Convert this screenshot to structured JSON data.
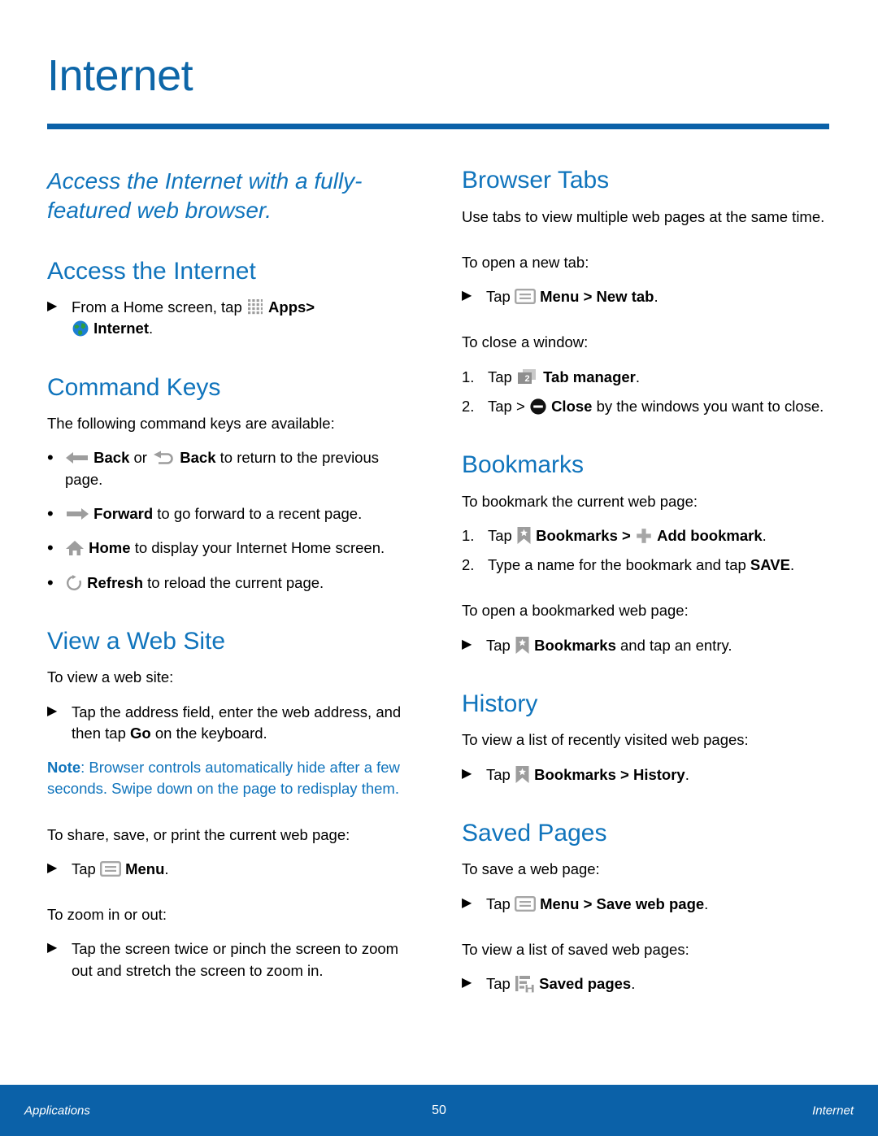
{
  "document": {
    "title": "Internet",
    "accent_color": "#0b61a8",
    "heading_color": "#1074bc",
    "lede": "Access the Internet with a fully-featured web browser."
  },
  "left_column": {
    "access": {
      "heading": "Access the Internet",
      "step": {
        "marker": "▶",
        "text_before_apps": "From a Home screen, tap",
        "apps_label": "Apps",
        "separator": ">",
        "internet_label": "Internet",
        "period": "."
      }
    },
    "command_keys": {
      "heading": "Command Keys",
      "intro": "The following command keys are available:",
      "items": [
        {
          "marker": "•",
          "icon": "back-arrow-icon",
          "label": "Back",
          "mid": "or",
          "icon2": "back-return-icon",
          "label2": "Back",
          "after": "to return to the previous page."
        },
        {
          "marker": "•",
          "icon": "forward-arrow-icon",
          "label": "Forward",
          "after": "to go forward to a recent page."
        },
        {
          "marker": "•",
          "icon": "home-icon",
          "label": "Home",
          "after": "to display your Internet Home screen."
        },
        {
          "marker": "•",
          "icon": "refresh-icon",
          "label": "Refresh",
          "after": "to reload the current page."
        }
      ]
    },
    "view_web_site": {
      "heading": "View a Web Site",
      "intro": "To view a web site:",
      "step": {
        "marker": "▶",
        "before": "Tap the address field, enter the web address, and then tap",
        "bold": "Go",
        "after": "on the keyboard."
      },
      "note": {
        "label": "Note",
        "colon": ":",
        "text": "Browser controls automatically hide after a few seconds. Swipe down on the page to redisplay them."
      },
      "share_intro": "To share, save, or print the current web page:",
      "share_step": {
        "marker": "▶",
        "before": "Tap",
        "menu_label": "Menu",
        "period": "."
      },
      "zoom_intro": "To zoom in or out:",
      "zoom_step": {
        "marker": "▶",
        "text": "Tap the screen twice or pinch the screen to zoom out and stretch the screen to zoom in."
      }
    }
  },
  "right_column": {
    "browser_tabs": {
      "heading": "Browser Tabs",
      "intro": "Use tabs to view multiple web pages at the same time.",
      "new_tab_intro": "To open a new tab:",
      "new_tab_step": {
        "marker": "▶",
        "before": "Tap",
        "menu_label": "Menu",
        "separator": ">",
        "target_label": "New tab",
        "period": "."
      },
      "close_intro": "To close a window:",
      "close_steps": [
        {
          "marker": "1.",
          "before": "Tap",
          "icon": "tab-manager-icon",
          "badge": "2",
          "label": "Tab manager",
          "period": "."
        },
        {
          "marker": "2.",
          "before": "Tap >",
          "icon": "close-icon",
          "label": "Close",
          "after": "by the windows you want to close."
        }
      ]
    },
    "bookmarks": {
      "heading": "Bookmarks",
      "add_intro": "To bookmark the current web page:",
      "add_steps": [
        {
          "marker": "1.",
          "before": "Tap",
          "bookmarks_label": "Bookmarks",
          "separator": ">",
          "add_label": "Add bookmark",
          "period": "."
        },
        {
          "marker": "2.",
          "before": "Type a name for the bookmark and tap",
          "bold": "SAVE",
          "period": "."
        }
      ],
      "open_intro": "To open a bookmarked web page:",
      "open_step": {
        "marker": "▶",
        "before": "Tap",
        "bookmarks_label": "Bookmarks",
        "after": "and tap an entry."
      }
    },
    "history": {
      "heading": "History",
      "intro": "To view a list of recently visited web pages:",
      "step": {
        "marker": "▶",
        "before": "Tap",
        "bookmarks_label": "Bookmarks",
        "separator": ">",
        "target_label": "History",
        "period": "."
      }
    },
    "saved_pages": {
      "heading": "Saved Pages",
      "save_intro": "To save a web page:",
      "save_step": {
        "marker": "▶",
        "before": "Tap",
        "menu_label": "Menu",
        "separator": ">",
        "target_label": "Save web page",
        "period": "."
      },
      "view_intro": "To view a list of saved web pages:",
      "view_step": {
        "marker": "▶",
        "before": "Tap",
        "label": "Saved pages",
        "period": "."
      }
    }
  },
  "footer": {
    "left": "Applications",
    "page_number": "50",
    "right": "Internet"
  }
}
